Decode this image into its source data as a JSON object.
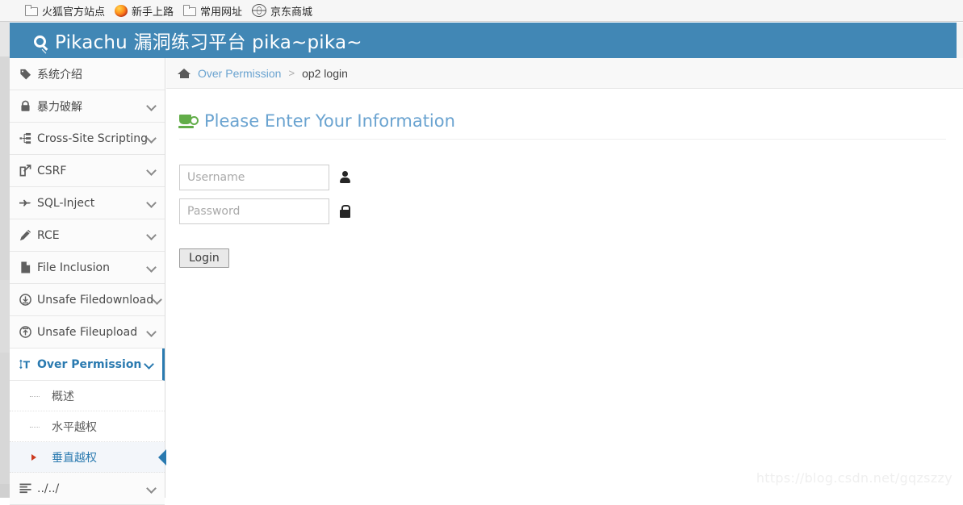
{
  "browser": {
    "bookmarks": [
      {
        "label": "火狐官方站点",
        "icon": "folder-icon"
      },
      {
        "label": "新手上路",
        "icon": "firefox-icon"
      },
      {
        "label": "常用网址",
        "icon": "folder-icon"
      },
      {
        "label": "京东商城",
        "icon": "globe-icon"
      }
    ]
  },
  "header": {
    "title": "Pikachu 漏洞练习平台 pika~pika~",
    "icon": "key-icon",
    "bg_color": "#4187b5"
  },
  "sidebar": {
    "items": [
      {
        "label": "系统介绍",
        "icon": "tag-icon",
        "caret": false,
        "active": false
      },
      {
        "label": "暴力破解",
        "icon": "lock-icon",
        "caret": true,
        "active": false
      },
      {
        "label": "Cross-Site Scripting",
        "icon": "sitemap-icon",
        "caret": true,
        "active": false
      },
      {
        "label": "CSRF",
        "icon": "external-link-icon",
        "caret": true,
        "active": false
      },
      {
        "label": "SQL-Inject",
        "icon": "plane-icon",
        "caret": true,
        "active": false
      },
      {
        "label": "RCE",
        "icon": "pencil-icon",
        "caret": true,
        "active": false
      },
      {
        "label": "File Inclusion",
        "icon": "file-icon",
        "caret": true,
        "active": false
      },
      {
        "label": "Unsafe Filedownload",
        "icon": "download-circle-icon",
        "caret": true,
        "active": false
      },
      {
        "label": "Unsafe Fileupload",
        "icon": "upload-circle-icon",
        "caret": true,
        "active": false
      },
      {
        "label": "Over Permission",
        "icon": "text-height-icon",
        "caret": true,
        "active": true
      }
    ],
    "submenu": [
      {
        "label": "概述",
        "active": false
      },
      {
        "label": "水平越权",
        "active": false
      },
      {
        "label": "垂直越权",
        "active": true
      }
    ],
    "footer_item": {
      "label": "../../",
      "icon": "align-left-icon",
      "caret": true
    },
    "active_color": "#2a7ab0"
  },
  "breadcrumb": {
    "home_icon": "home-icon",
    "parent": "Over Permission",
    "separator": ">",
    "current": "op2 login"
  },
  "panel": {
    "title": "Please Enter Your Information",
    "title_icon": "coffee-mug-icon",
    "title_color": "#6aa3d0",
    "form": {
      "username": {
        "value": "",
        "placeholder": "Username",
        "icon": "user-icon"
      },
      "password": {
        "value": "",
        "placeholder": "Password",
        "icon": "lock-icon"
      },
      "submit_label": "Login"
    }
  },
  "watermark": {
    "text": "https://blog.csdn.net/gqzszzy"
  }
}
